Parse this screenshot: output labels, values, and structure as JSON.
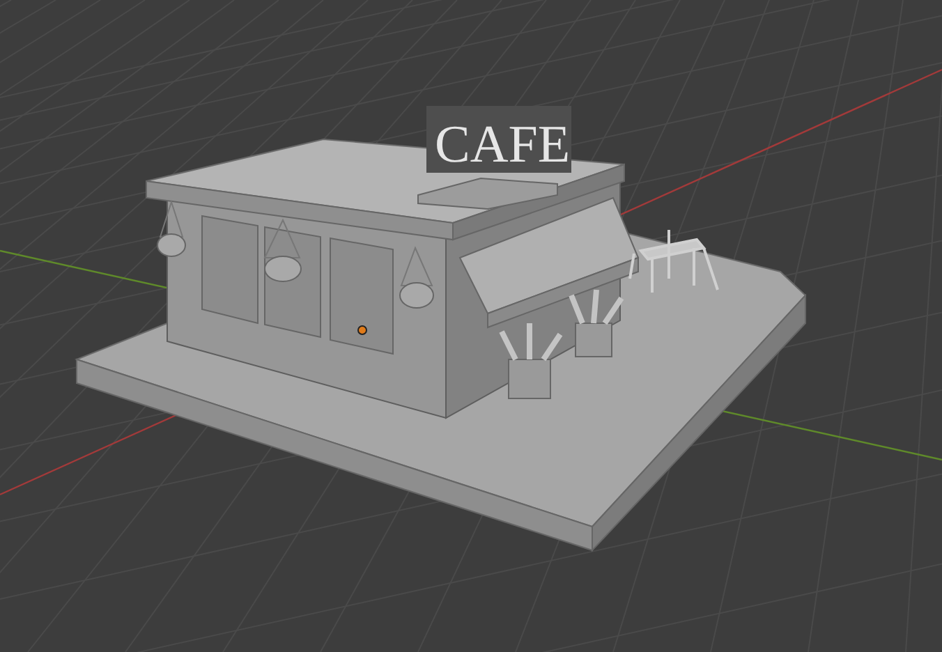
{
  "viewport": {
    "sign_text": "CAFE"
  }
}
